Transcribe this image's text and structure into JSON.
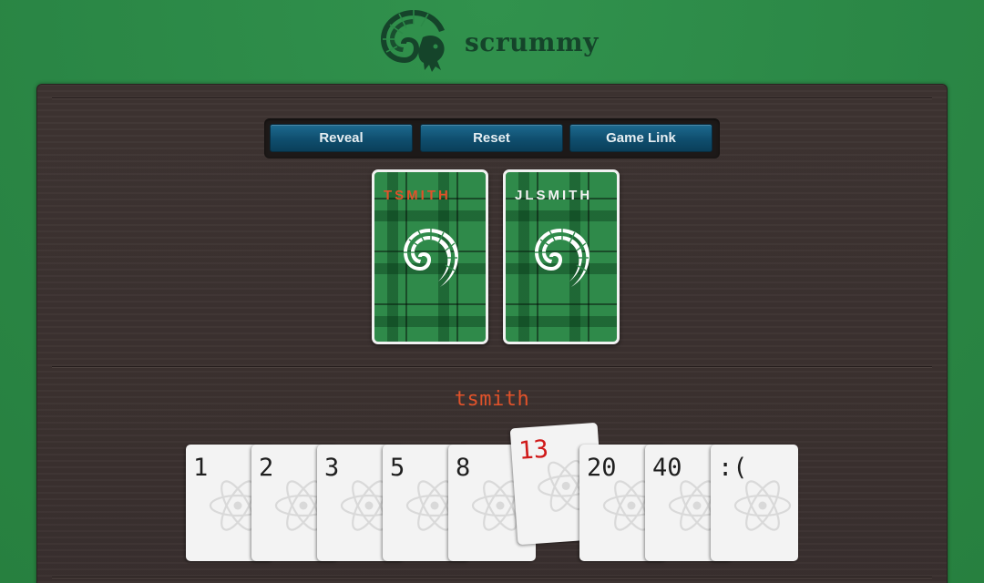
{
  "app": {
    "brand": "scrummy",
    "accent_color": "#e0522a",
    "felt_color": "#2c8a48",
    "button_color": "#0f4e6e"
  },
  "toolbar": {
    "buttons": [
      {
        "label": "Reveal",
        "icon": null
      },
      {
        "label": "Reset",
        "icon": null
      },
      {
        "label": "Game Link",
        "icon": null
      }
    ]
  },
  "table": {
    "played_cards": [
      {
        "player": "TSMITH",
        "name_color": "#e0522a",
        "face": "down",
        "back_icon": "ram-horn-icon"
      },
      {
        "player": "JLSMITH",
        "name_color": "#f2f2f2",
        "face": "down",
        "back_icon": "ram-horn-icon"
      }
    ]
  },
  "current_user": {
    "name": "tsmith"
  },
  "hand": {
    "card_icon": "atom-icon",
    "selected": "13",
    "cards": [
      "1",
      "2",
      "3",
      "5",
      "8",
      "13",
      "20",
      "40",
      ":("
    ]
  }
}
